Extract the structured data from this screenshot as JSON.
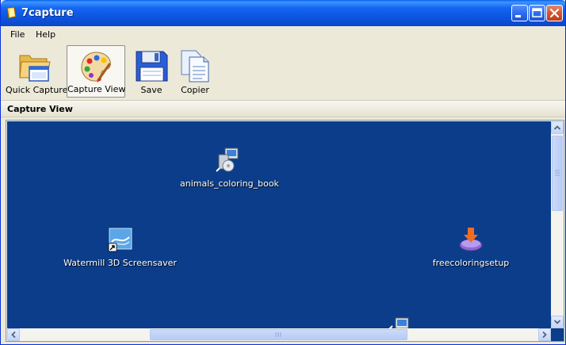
{
  "window": {
    "title": "7capture",
    "title_icon": "app-icon"
  },
  "menu": {
    "items": [
      {
        "label": "File"
      },
      {
        "label": "Help"
      }
    ]
  },
  "toolbar": {
    "buttons": [
      {
        "label": "Quick Capture",
        "icon": "folder-window-icon"
      },
      {
        "label": "Capture View",
        "icon": "palette-icon",
        "active": true
      },
      {
        "label": "Save",
        "icon": "floppy-disk-icon"
      },
      {
        "label": "Copier",
        "icon": "copy-documents-icon"
      }
    ]
  },
  "section": {
    "title": "Capture View"
  },
  "desktop": {
    "background_color": "#0b3d8a",
    "icons": [
      {
        "label": "animals_coloring_book",
        "icon": "installer-icon"
      },
      {
        "label": "Watermill 3D Screensaver",
        "icon": "screensaver-shortcut-icon"
      },
      {
        "label": "freecoloringsetup",
        "icon": "setup-download-icon"
      }
    ]
  },
  "colors": {
    "title_bar": "#0c53dd",
    "window_bg": "#ece9d8",
    "close_button": "#d6552e"
  }
}
